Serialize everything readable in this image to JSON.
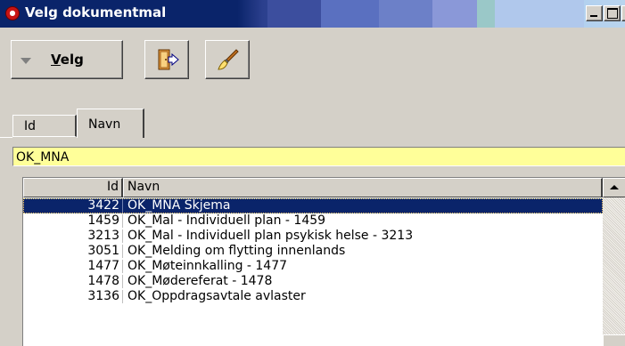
{
  "window": {
    "title": "Velg dokumentmal",
    "app_icon": "app-logo-icon"
  },
  "toolbar": {
    "velg_label": "Velg",
    "exit_icon": "exit-door-icon",
    "brush_icon": "paintbrush-icon"
  },
  "tabs": [
    {
      "label": "Id",
      "active": false
    },
    {
      "label": "Navn",
      "active": true
    }
  ],
  "search": {
    "value": "OK_MNA"
  },
  "list": {
    "headers": {
      "id": "Id",
      "name": "Navn"
    },
    "rows": [
      {
        "id": "3422",
        "name": "OK_MNA Skjema",
        "selected": true
      },
      {
        "id": "1459",
        "name": "OK_Mal - Individuell plan - 1459"
      },
      {
        "id": "3213",
        "name": "OK_Mal - Individuell plan psykisk helse - 3213"
      },
      {
        "id": "3051",
        "name": "OK_Melding om flytting innenlands"
      },
      {
        "id": "1477",
        "name": "OK_Møteinnkalling - 1477"
      },
      {
        "id": "1478",
        "name": "OK_Mødereferat - 1478"
      },
      {
        "id": "3136",
        "name": "OK_Oppdragsavtale avlaster"
      }
    ]
  },
  "colors": {
    "selection": "#0a246a",
    "search_bg": "#ffff99",
    "face": "#d4d0c8"
  }
}
